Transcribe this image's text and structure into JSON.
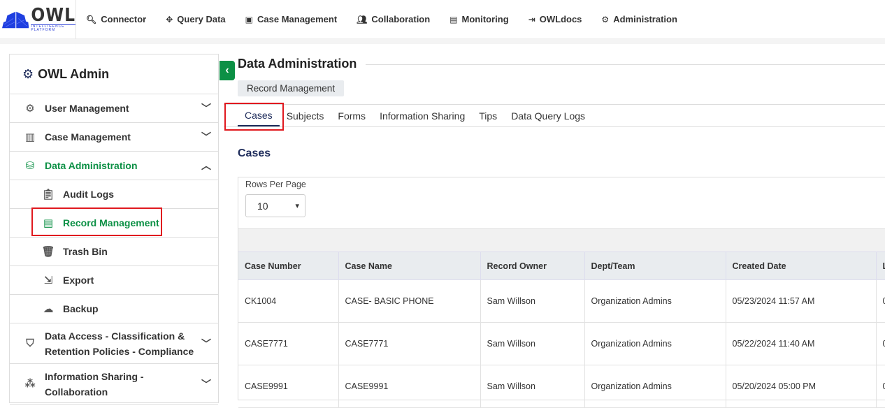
{
  "logo": {
    "text": "OWL",
    "sub": "INTELLIGENCE PLATFORM"
  },
  "nav": [
    {
      "label": "Connector",
      "icon": "search-icon"
    },
    {
      "label": "Query Data",
      "icon": "move-icon"
    },
    {
      "label": "Case Management",
      "icon": "contact-book-icon"
    },
    {
      "label": "Collaboration",
      "icon": "users-icon"
    },
    {
      "label": "Monitoring",
      "icon": "monitor-icon"
    },
    {
      "label": "OWLdocs",
      "icon": "document-icon"
    },
    {
      "label": "Administration",
      "icon": "users-gear-icon"
    }
  ],
  "sidebar": {
    "title": "OWL Admin",
    "items": [
      {
        "label": "User Management"
      },
      {
        "label": "Case Management"
      },
      {
        "label": "Data Administration"
      },
      {
        "label": "Audit Logs"
      },
      {
        "label": "Record Management"
      },
      {
        "label": "Trash Bin"
      },
      {
        "label": "Export"
      },
      {
        "label": "Backup"
      },
      {
        "label": "Data Access - Classification & Retention Policies - Compliance"
      },
      {
        "label": "Information Sharing - Collaboration"
      }
    ]
  },
  "main": {
    "title": "Data Administration",
    "chip": "Record Management",
    "tabs": [
      "Cases",
      "Subjects",
      "Forms",
      "Information Sharing",
      "Tips",
      "Data Query Logs"
    ],
    "section": "Cases",
    "rows_per_page_label": "Rows Per Page",
    "rows_per_page": "10",
    "columns": [
      "Case Number",
      "Case Name",
      "Record Owner",
      "Dept/Team",
      "Created Date",
      "L"
    ],
    "rows": [
      [
        "CK1004",
        "CASE- BASIC PHONE",
        "Sam Willson",
        "Organization Admins",
        "05/23/2024 11:57 AM",
        "0"
      ],
      [
        "CASE7771",
        "CASE7771",
        "Sam Willson",
        "Organization Admins",
        "05/22/2024 11:40 AM",
        "0"
      ],
      [
        "CASE9991",
        "CASE9991",
        "Sam Willson",
        "Organization Admins",
        "05/20/2024 05:00 PM",
        "0"
      ]
    ]
  },
  "colors": {
    "accent": "#0c9045",
    "highlight": "#e0191f",
    "navy": "#1d2b5a"
  }
}
